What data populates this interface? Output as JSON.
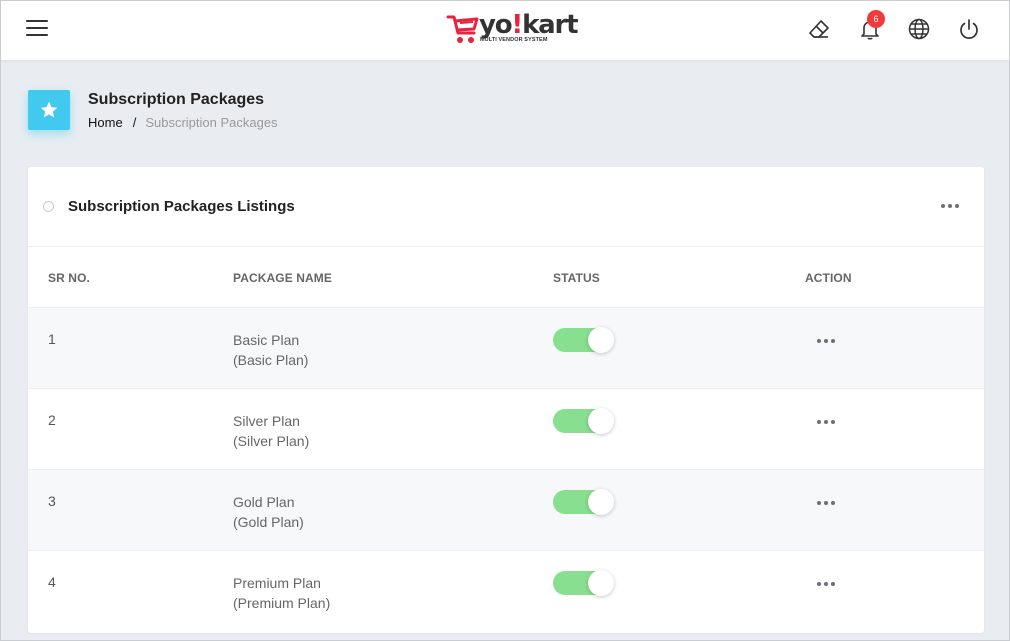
{
  "brand": {
    "logo_text_a": "yo",
    "logo_text_excl": "!",
    "logo_text_b": "kart",
    "tagline": "MULTI VENDOR SYSTEM",
    "logo_color": "#e8233d"
  },
  "header": {
    "notification_count": "6",
    "icons": [
      "menu-icon",
      "eraser-icon",
      "bell-icon",
      "globe-icon",
      "power-icon"
    ]
  },
  "page": {
    "title": "Subscription Packages",
    "title_icon": "star-icon",
    "accent_color": "#41c9ef",
    "breadcrumb": {
      "home": "Home",
      "separator": "/",
      "current": "Subscription Packages"
    }
  },
  "card": {
    "title": "Subscription Packages Listings"
  },
  "table": {
    "columns": [
      "SR NO.",
      "PACKAGE NAME",
      "STATUS",
      "ACTION"
    ],
    "rows": [
      {
        "sr": "1",
        "name": "Basic Plan",
        "subname": "(Basic Plan)",
        "status_active": true
      },
      {
        "sr": "2",
        "name": "Silver Plan",
        "subname": "(Silver Plan)",
        "status_active": true
      },
      {
        "sr": "3",
        "name": "Gold Plan",
        "subname": "(Gold Plan)",
        "status_active": true
      },
      {
        "sr": "4",
        "name": "Premium Plan",
        "subname": "(Premium Plan)",
        "status_active": true
      }
    ],
    "toggle_on_color": "#88df8f"
  }
}
